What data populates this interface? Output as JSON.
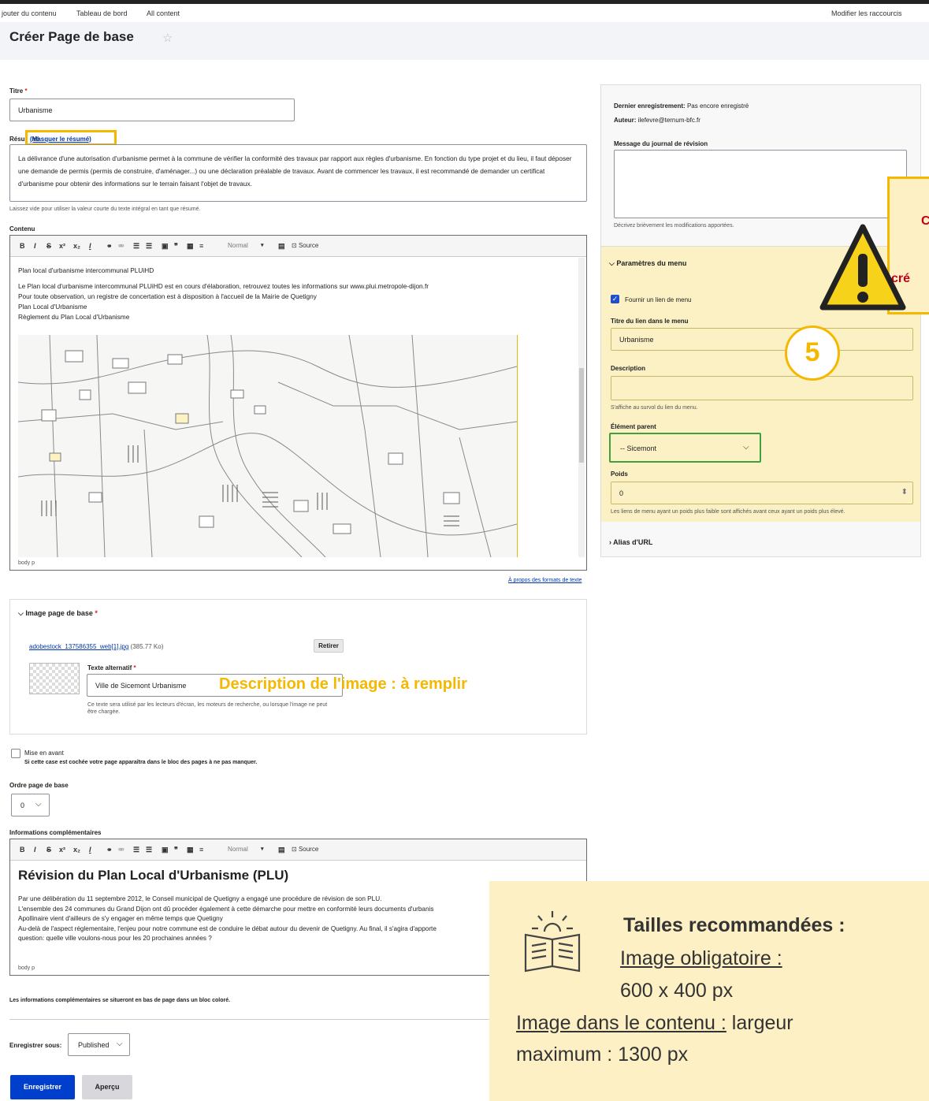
{
  "toolbar": {
    "add_content": "jouter du contenu",
    "dashboard": "Tableau de bord",
    "all_content": "All content",
    "shortcuts": "Modifier les raccourcis"
  },
  "page": {
    "title": "Créer Page de base",
    "star": "☆"
  },
  "form": {
    "title_label": "Titre",
    "required_mark": "*",
    "title_value": "Urbanisme",
    "summary_label_start": "Résu",
    "summary_label_end": "né",
    "summary_toggle": "(Masquer le résumé)",
    "summary_text": "La délivrance d'une autorisation d'urbanisme permet à la commune de vérifier la conformité des travaux par rapport aux règles d'urbanisme. En fonction du type projet et du lieu, il faut déposer une demande de permis (permis de construire, d'aménager...) ou une déclaration préalable de travaux. Avant de commencer les travaux, il est recommandé de demander un certificat d'urbanisme pour obtenir des informations sur le terrain faisant l'objet de travaux.",
    "summary_help": "Laissez vide pour utiliser la valeur courte du texte intégral en tant que résumé.",
    "content_label": "Contenu",
    "content_lines": [
      "Plan local d'urbanisme intercommunal PLUiHD",
      "Le Plan local d'urbanisme intercommunal PLUiHD est en cours d'élaboration, retrouvez toutes les informations sur www.plui.metropole-dijon.fr",
      "Pour toute observation, un registre de concertation est à disposition à l'accueil de la Mairie de Quetigny",
      "Plan Local d'Urbanisme",
      "Règlement du Plan Local d'Urbanisme"
    ],
    "editor_footer": "body  p",
    "text_formats_link": "À propos des formats de texte",
    "image_section": "Image page de base",
    "image_file": "adobestock_137586355_web[1].jpg",
    "image_size": "(385.77 Ko)",
    "remove_button": "Retirer",
    "alt_label": "Texte alternatif",
    "alt_value": "Ville de Sicemont Urbanisme",
    "alt_help": "Ce texte sera utilisé par les lecteurs d'écran, les moteurs de recherche, ou lorsque l'image ne peut être chargée.",
    "featured_label": "Mise en avant",
    "featured_help": "Si cette case est cochée votre page apparaîtra dans le bloc des pages à ne pas manquer.",
    "order_label": "Ordre page de base",
    "order_value": "0",
    "extra_label": "Informations complémentaires",
    "extra_heading": "Révision du Plan Local d'Urbanisme (PLU)",
    "extra_lines": [
      "Par une délibération du 11 septembre 2012, le Conseil municipal de Quetigny a engagé une procédure de révision de son PLU.",
      "L'ensemble des 24 communes du Grand Dijon ont dû procéder également à cette démarche pour mettre en conformité leurs documents d'urbanis",
      "Apollinaire vient d'ailleurs de s'y engager en même temps que Quetigny",
      "Au-delà de l'aspect réglementaire, l'enjeu pour notre commune est de conduire le débat autour du devenir de Quetigny. Au final, il s'agira d'apporte",
      "question: quelle ville voulons-nous pour les 20 prochaines années ?"
    ],
    "extra_help": "Les informations complémentaires se situeront en bas de page dans un bloc coloré.",
    "save_as_label": "Enregistrer sous:",
    "save_as_value": "Published",
    "save_button": "Enregistrer",
    "preview_button": "Aperçu"
  },
  "editor_toolbar": {
    "bold": "B",
    "italic": "I",
    "strike": "S",
    "sup": "x²",
    "sub": "x₂",
    "format_select": "Normal",
    "source": "Source"
  },
  "sidebar": {
    "last_saved_label": "Dernier enregistrement:",
    "last_saved_value": "Pas encore enregistré",
    "author_label": "Auteur:",
    "author_value": "ilefevre@ternum-bfc.fr",
    "revision_label": "Message du journal de révision",
    "revision_help": "Décrivez brièvement les modifications apportées.",
    "menu_section": "Paramètres du menu",
    "provide_menu_link": "Fournir un lien de menu",
    "menu_link_title_label": "Titre du lien dans le menu",
    "menu_link_title_value": "Urbanisme",
    "description_label": "Description",
    "description_help": "S'affiche au survol du lien du menu.",
    "parent_label": "Élément parent",
    "parent_value": "-- Sicemont",
    "weight_label": "Poids",
    "weight_value": "0",
    "weight_help": "Les liens de menu ayant un poids plus faible sont affichés avant ceux ayant un poids plus élevé.",
    "url_alias_section": "Alias d'URL"
  },
  "annotations": {
    "callout_top": "C",
    "callout_bottom": "cré",
    "step_number": "5",
    "image_desc_word": "Description",
    "image_desc_rest": " de l'image : à remplir",
    "tips_title": "Tailles recommandées :",
    "tips_required": "Image obligatoire :",
    "tips_required_size": "600 x 400 px",
    "tips_content_label": "Image dans le contenu :",
    "tips_content_rest": " largeur",
    "tips_content_max": "maximum : 1300 px"
  },
  "colors": {
    "accent_yellow": "#f5b800",
    "highlight_bg": "#fbf1c5",
    "tips_bg": "#fdf0c4",
    "primary_button": "#003ecc",
    "callout_red": "#c0001a",
    "focus_green": "#3fa03f"
  }
}
